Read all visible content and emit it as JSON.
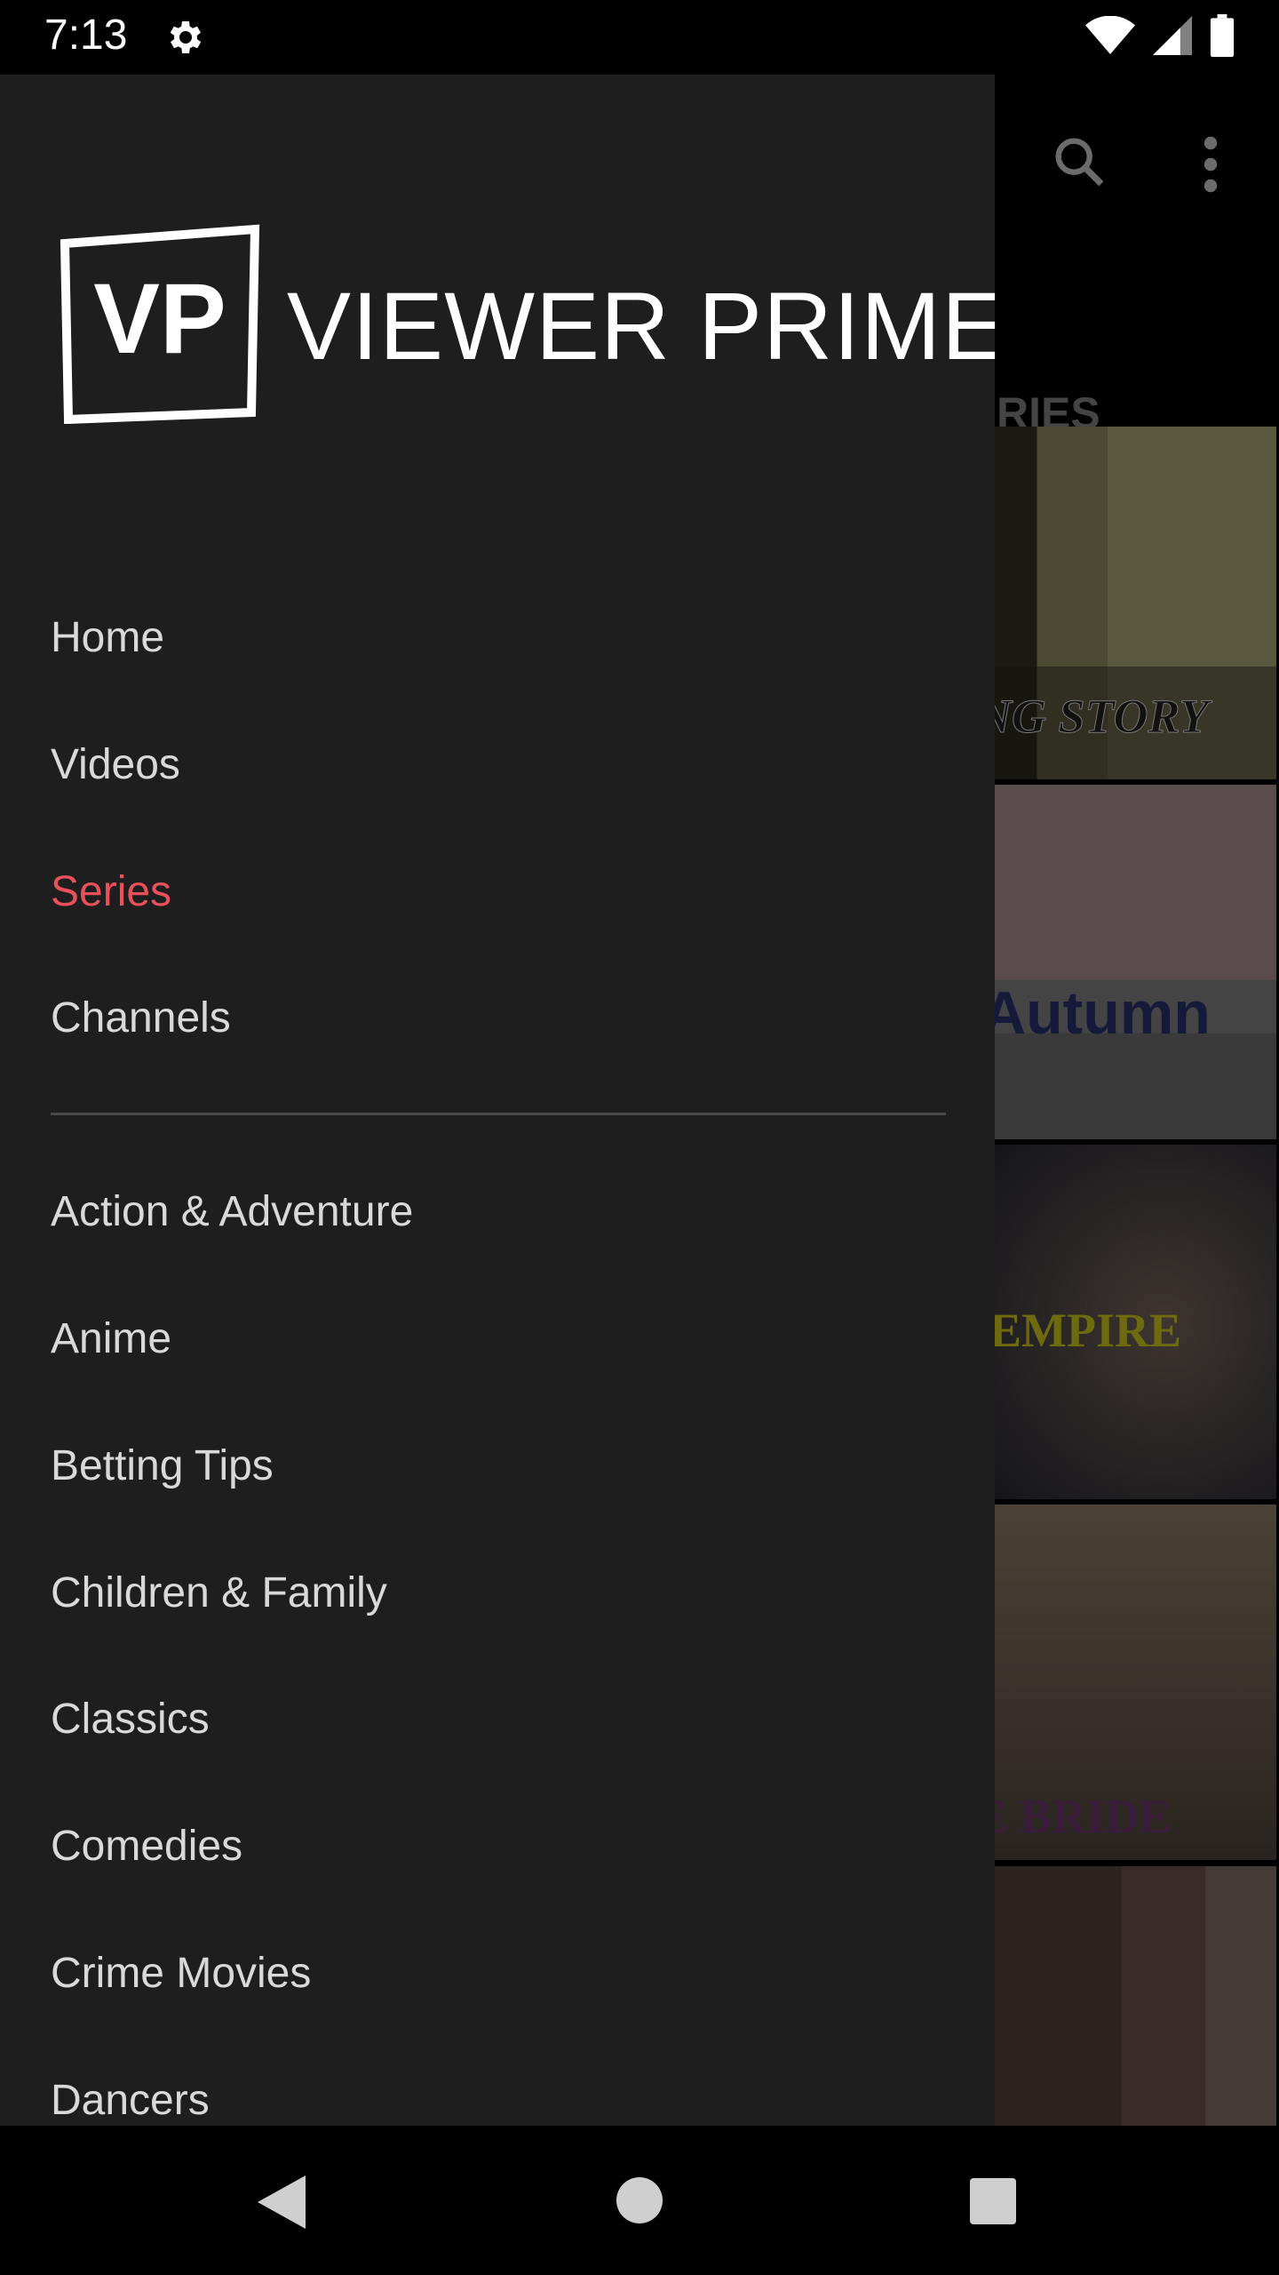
{
  "status_bar": {
    "time": "7:13",
    "icons": [
      "gear-icon",
      "wifi-icon",
      "signal-icon",
      "battery-icon"
    ]
  },
  "app": {
    "toolbar_icons": [
      "search-icon",
      "more-vert-icon"
    ],
    "tab_partial": "RIES",
    "thumbnails": [
      {
        "caption": "NG STORY"
      },
      {
        "caption": "Autumn"
      },
      {
        "caption": "EMPIRE"
      },
      {
        "caption": "E BRIDE"
      },
      {
        "caption": ""
      }
    ]
  },
  "drawer": {
    "logo_mark": "VP",
    "logo_text": "VIEWER PRIME",
    "main_items": [
      {
        "label": "Home"
      },
      {
        "label": "Videos"
      },
      {
        "label": "Series",
        "active": true
      },
      {
        "label": "Channels"
      }
    ],
    "categories": [
      {
        "label": "Action & Adventure"
      },
      {
        "label": "Anime"
      },
      {
        "label": "Betting Tips"
      },
      {
        "label": "Children & Family"
      },
      {
        "label": "Classics"
      },
      {
        "label": "Comedies"
      },
      {
        "label": "Crime Movies"
      },
      {
        "label": "Dancers"
      }
    ],
    "active_color": "#e8505b"
  },
  "nav_bar": {
    "buttons": [
      "back-icon",
      "home-icon",
      "recents-icon"
    ]
  }
}
